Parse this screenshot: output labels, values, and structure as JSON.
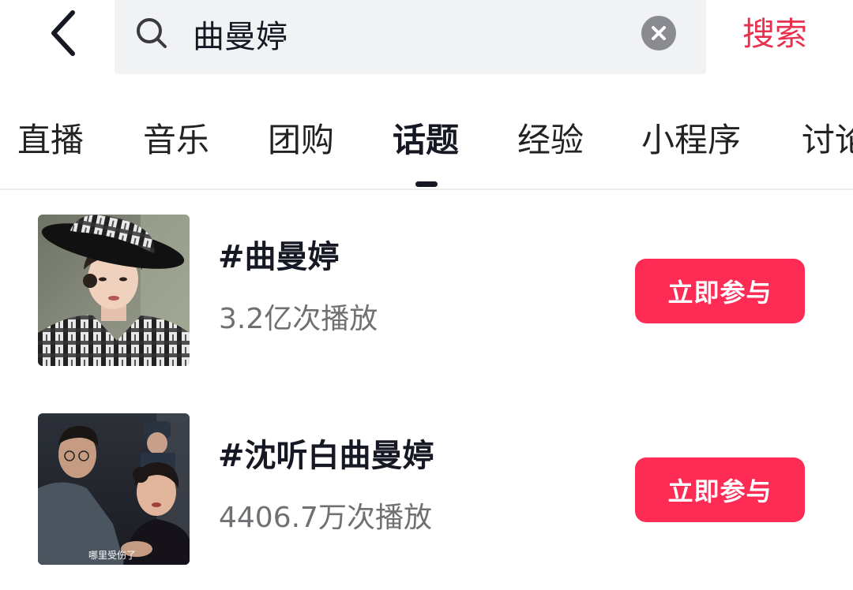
{
  "search": {
    "query": "曲曼婷",
    "action_label": "搜索"
  },
  "tabs": [
    {
      "label": "直播"
    },
    {
      "label": "音乐"
    },
    {
      "label": "团购"
    },
    {
      "label": "话题",
      "active": true
    },
    {
      "label": "经验"
    },
    {
      "label": "小程序"
    },
    {
      "label": "讨论"
    }
  ],
  "topics": [
    {
      "title": "#曲曼婷",
      "plays": "3.2亿次播放",
      "button_label": "立即参与"
    },
    {
      "title": "#沈听白曲曼婷",
      "plays": "4406.7万次播放",
      "button_label": "立即参与",
      "thumb_caption": "哪里受伤了"
    }
  ],
  "colors": {
    "accent": "#fe2c55",
    "search_action": "#e8304f",
    "search_bg": "#f1f2f3"
  },
  "icons": {
    "back": "chevron-left-icon",
    "search": "search-icon",
    "clear": "close-circle-icon"
  }
}
